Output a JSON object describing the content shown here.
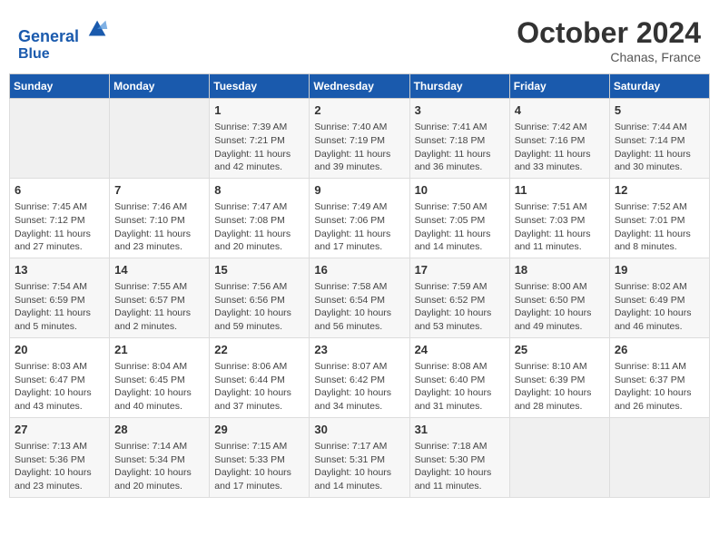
{
  "header": {
    "logo_line1": "General",
    "logo_line2": "Blue",
    "month": "October 2024",
    "location": "Chanas, France"
  },
  "days_of_week": [
    "Sunday",
    "Monday",
    "Tuesday",
    "Wednesday",
    "Thursday",
    "Friday",
    "Saturday"
  ],
  "weeks": [
    [
      {
        "day": "",
        "info": ""
      },
      {
        "day": "",
        "info": ""
      },
      {
        "day": "1",
        "info": "Sunrise: 7:39 AM\nSunset: 7:21 PM\nDaylight: 11 hours and 42 minutes."
      },
      {
        "day": "2",
        "info": "Sunrise: 7:40 AM\nSunset: 7:19 PM\nDaylight: 11 hours and 39 minutes."
      },
      {
        "day": "3",
        "info": "Sunrise: 7:41 AM\nSunset: 7:18 PM\nDaylight: 11 hours and 36 minutes."
      },
      {
        "day": "4",
        "info": "Sunrise: 7:42 AM\nSunset: 7:16 PM\nDaylight: 11 hours and 33 minutes."
      },
      {
        "day": "5",
        "info": "Sunrise: 7:44 AM\nSunset: 7:14 PM\nDaylight: 11 hours and 30 minutes."
      }
    ],
    [
      {
        "day": "6",
        "info": "Sunrise: 7:45 AM\nSunset: 7:12 PM\nDaylight: 11 hours and 27 minutes."
      },
      {
        "day": "7",
        "info": "Sunrise: 7:46 AM\nSunset: 7:10 PM\nDaylight: 11 hours and 23 minutes."
      },
      {
        "day": "8",
        "info": "Sunrise: 7:47 AM\nSunset: 7:08 PM\nDaylight: 11 hours and 20 minutes."
      },
      {
        "day": "9",
        "info": "Sunrise: 7:49 AM\nSunset: 7:06 PM\nDaylight: 11 hours and 17 minutes."
      },
      {
        "day": "10",
        "info": "Sunrise: 7:50 AM\nSunset: 7:05 PM\nDaylight: 11 hours and 14 minutes."
      },
      {
        "day": "11",
        "info": "Sunrise: 7:51 AM\nSunset: 7:03 PM\nDaylight: 11 hours and 11 minutes."
      },
      {
        "day": "12",
        "info": "Sunrise: 7:52 AM\nSunset: 7:01 PM\nDaylight: 11 hours and 8 minutes."
      }
    ],
    [
      {
        "day": "13",
        "info": "Sunrise: 7:54 AM\nSunset: 6:59 PM\nDaylight: 11 hours and 5 minutes."
      },
      {
        "day": "14",
        "info": "Sunrise: 7:55 AM\nSunset: 6:57 PM\nDaylight: 11 hours and 2 minutes."
      },
      {
        "day": "15",
        "info": "Sunrise: 7:56 AM\nSunset: 6:56 PM\nDaylight: 10 hours and 59 minutes."
      },
      {
        "day": "16",
        "info": "Sunrise: 7:58 AM\nSunset: 6:54 PM\nDaylight: 10 hours and 56 minutes."
      },
      {
        "day": "17",
        "info": "Sunrise: 7:59 AM\nSunset: 6:52 PM\nDaylight: 10 hours and 53 minutes."
      },
      {
        "day": "18",
        "info": "Sunrise: 8:00 AM\nSunset: 6:50 PM\nDaylight: 10 hours and 49 minutes."
      },
      {
        "day": "19",
        "info": "Sunrise: 8:02 AM\nSunset: 6:49 PM\nDaylight: 10 hours and 46 minutes."
      }
    ],
    [
      {
        "day": "20",
        "info": "Sunrise: 8:03 AM\nSunset: 6:47 PM\nDaylight: 10 hours and 43 minutes."
      },
      {
        "day": "21",
        "info": "Sunrise: 8:04 AM\nSunset: 6:45 PM\nDaylight: 10 hours and 40 minutes."
      },
      {
        "day": "22",
        "info": "Sunrise: 8:06 AM\nSunset: 6:44 PM\nDaylight: 10 hours and 37 minutes."
      },
      {
        "day": "23",
        "info": "Sunrise: 8:07 AM\nSunset: 6:42 PM\nDaylight: 10 hours and 34 minutes."
      },
      {
        "day": "24",
        "info": "Sunrise: 8:08 AM\nSunset: 6:40 PM\nDaylight: 10 hours and 31 minutes."
      },
      {
        "day": "25",
        "info": "Sunrise: 8:10 AM\nSunset: 6:39 PM\nDaylight: 10 hours and 28 minutes."
      },
      {
        "day": "26",
        "info": "Sunrise: 8:11 AM\nSunset: 6:37 PM\nDaylight: 10 hours and 26 minutes."
      }
    ],
    [
      {
        "day": "27",
        "info": "Sunrise: 7:13 AM\nSunset: 5:36 PM\nDaylight: 10 hours and 23 minutes."
      },
      {
        "day": "28",
        "info": "Sunrise: 7:14 AM\nSunset: 5:34 PM\nDaylight: 10 hours and 20 minutes."
      },
      {
        "day": "29",
        "info": "Sunrise: 7:15 AM\nSunset: 5:33 PM\nDaylight: 10 hours and 17 minutes."
      },
      {
        "day": "30",
        "info": "Sunrise: 7:17 AM\nSunset: 5:31 PM\nDaylight: 10 hours and 14 minutes."
      },
      {
        "day": "31",
        "info": "Sunrise: 7:18 AM\nSunset: 5:30 PM\nDaylight: 10 hours and 11 minutes."
      },
      {
        "day": "",
        "info": ""
      },
      {
        "day": "",
        "info": ""
      }
    ]
  ]
}
